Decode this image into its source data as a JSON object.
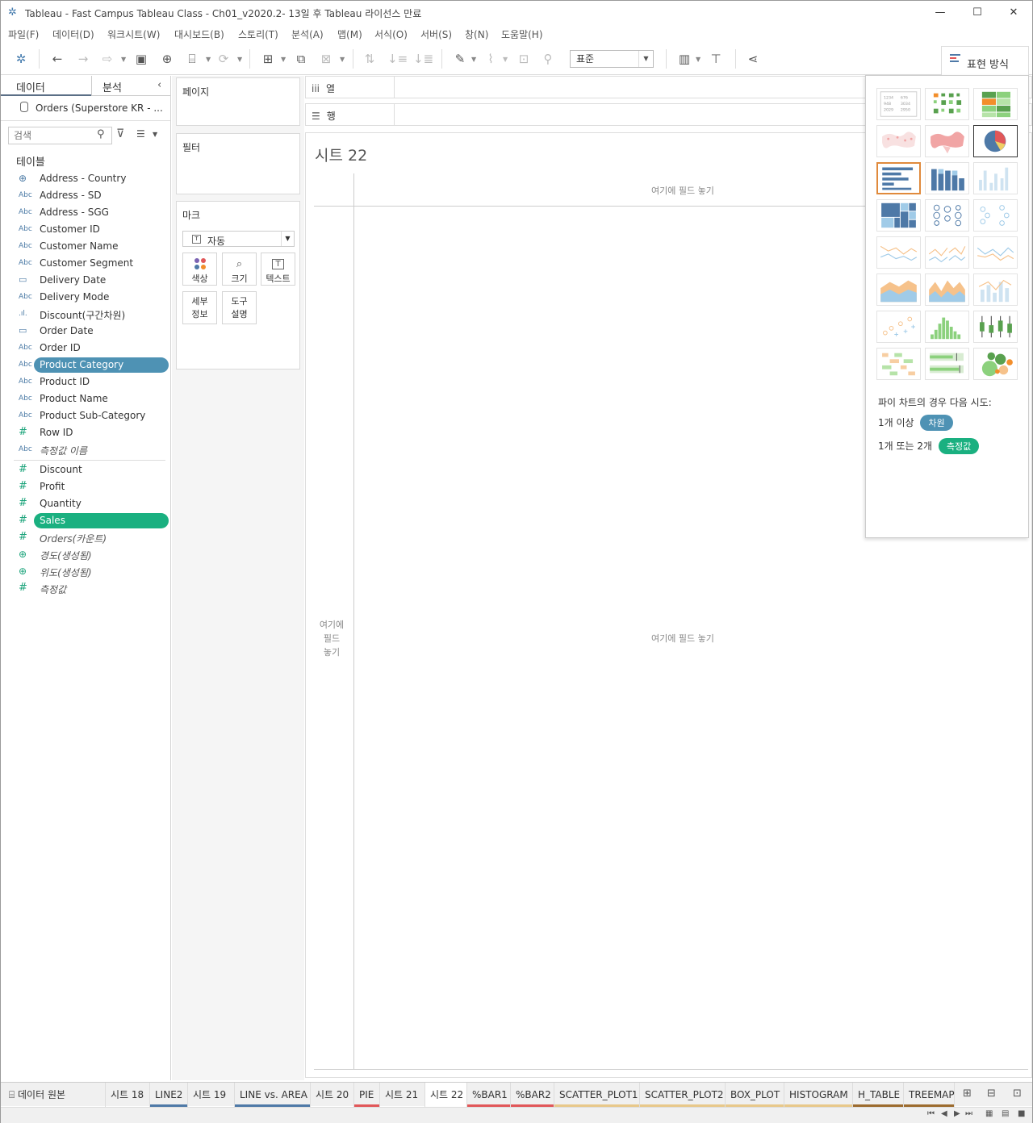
{
  "window": {
    "title": "Tableau - Fast Campus Tableau Class - Ch01_v2020.2- 13일 후 Tableau 라이선스 만료"
  },
  "menu": [
    "파일(F)",
    "데이터(D)",
    "워크시트(W)",
    "대시보드(B)",
    "스토리(T)",
    "분석(A)",
    "맵(M)",
    "서식(O)",
    "서버(S)",
    "창(N)",
    "도움말(H)"
  ],
  "toolbar": {
    "fit_select": "표준",
    "show_me_label": "표현 방식"
  },
  "data_pane": {
    "tab_data": "데이터",
    "tab_analysis": "분석",
    "datasource": "Orders (Superstore KR - ...",
    "search_placeholder": "검색",
    "tables_header": "테이블",
    "dimensions": [
      {
        "name": "Address - Country",
        "type": "geo"
      },
      {
        "name": "Address - SD",
        "type": "abc"
      },
      {
        "name": "Address - SGG",
        "type": "abc"
      },
      {
        "name": "Customer ID",
        "type": "abc"
      },
      {
        "name": "Customer Name",
        "type": "abc"
      },
      {
        "name": "Customer Segment",
        "type": "abc"
      },
      {
        "name": "Delivery Date",
        "type": "date"
      },
      {
        "name": "Delivery Mode",
        "type": "abc"
      },
      {
        "name": "Discount(구간차원)",
        "type": "bin"
      },
      {
        "name": "Order Date",
        "type": "date"
      },
      {
        "name": "Order ID",
        "type": "abc"
      },
      {
        "name": "Product Category",
        "type": "abc",
        "selected": true
      },
      {
        "name": "Product ID",
        "type": "abc"
      },
      {
        "name": "Product Name",
        "type": "abc"
      },
      {
        "name": "Product Sub-Category",
        "type": "abc"
      },
      {
        "name": "Row ID",
        "type": "num"
      },
      {
        "name": "측정값 이름",
        "type": "abc",
        "italic": true
      }
    ],
    "measures": [
      {
        "name": "Discount",
        "type": "num"
      },
      {
        "name": "Profit",
        "type": "num"
      },
      {
        "name": "Quantity",
        "type": "num"
      },
      {
        "name": "Sales",
        "type": "num",
        "selected": true
      },
      {
        "name": "Orders(카운트)",
        "type": "num",
        "italic": true
      },
      {
        "name": "경도(생성됨)",
        "type": "geo",
        "italic": true
      },
      {
        "name": "위도(생성됨)",
        "type": "geo",
        "italic": true
      },
      {
        "name": "측정값",
        "type": "num",
        "italic": true
      }
    ]
  },
  "cards": {
    "pages": "페이지",
    "filters": "필터",
    "marks": "마크",
    "mark_type": "자동",
    "mark_buttons": {
      "color": "색상",
      "size": "크기",
      "text": "텍스트",
      "detail": [
        "세부",
        "정보"
      ],
      "tooltip": [
        "도구",
        "설명"
      ]
    }
  },
  "shelves": {
    "columns": "열",
    "rows": "행"
  },
  "viz": {
    "sheet_title": "시트 22",
    "drop_hint": "여기에 필드 놓기",
    "drop_hint_left": [
      "여기에",
      "필드",
      "놓기"
    ]
  },
  "show_me": {
    "hint": "파이 차트의 경우 다음 시도:",
    "req1_prefix": "1개 이상",
    "req1_chip": "차원",
    "req2_prefix": "1개 또는 2개",
    "req2_chip": "측정값",
    "dimension_color": "#4e92b4",
    "measure_color": "#1ab080"
  },
  "sheet_tabs": [
    {
      "label": "데이터 원본",
      "color": ""
    },
    {
      "label": "시트 18",
      "color": ""
    },
    {
      "label": "LINE2",
      "color": "#4e79a7"
    },
    {
      "label": "시트 19",
      "color": ""
    },
    {
      "label": "LINE vs. AREA",
      "color": "#4e79a7"
    },
    {
      "label": "시트 20",
      "color": ""
    },
    {
      "label": "PIE",
      "color": "#e15759"
    },
    {
      "label": "시트 21",
      "color": ""
    },
    {
      "label": "시트 22",
      "color": "",
      "active": true
    },
    {
      "label": "%BAR1",
      "color": "#e15759"
    },
    {
      "label": "%BAR2",
      "color": "#e15759"
    },
    {
      "label": "SCATTER_PLOT1",
      "color": "#e8c88a"
    },
    {
      "label": "SCATTER_PLOT2",
      "color": "#e8c88a"
    },
    {
      "label": "BOX_PLOT",
      "color": "#e8c88a"
    },
    {
      "label": "HISTOGRAM",
      "color": "#e8c88a"
    },
    {
      "label": "H_TABLE",
      "color": "#9c6b2e"
    },
    {
      "label": "TREEMAP",
      "color": "#9c6b2e"
    }
  ]
}
